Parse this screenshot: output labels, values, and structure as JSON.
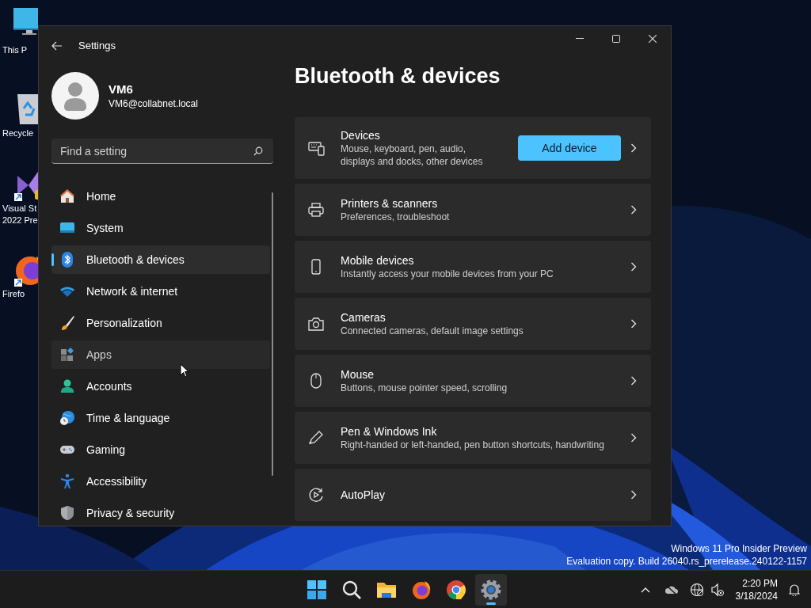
{
  "desktop_icons": [
    {
      "kind": "pc",
      "lines": [
        "This P"
      ]
    },
    {
      "kind": "recycle",
      "lines": [
        "Recycle"
      ]
    },
    {
      "kind": "vs",
      "lines": [
        "Visual St",
        "2022 Pre"
      ]
    },
    {
      "kind": "firefox",
      "lines": [
        "Firefo"
      ]
    }
  ],
  "window": {
    "title": "Settings",
    "user": {
      "name": "VM6",
      "email": "VM6@collabnet.local"
    },
    "search": {
      "placeholder": "Find a setting"
    },
    "nav": [
      {
        "kind": "home",
        "label": "Home",
        "selected": false,
        "hovered": false
      },
      {
        "kind": "system",
        "label": "System",
        "selected": false,
        "hovered": false
      },
      {
        "kind": "bluetooth",
        "label": "Bluetooth & devices",
        "selected": true,
        "hovered": false
      },
      {
        "kind": "network",
        "label": "Network & internet",
        "selected": false,
        "hovered": false
      },
      {
        "kind": "brush",
        "label": "Personalization",
        "selected": false,
        "hovered": false
      },
      {
        "kind": "apps",
        "label": "Apps",
        "selected": false,
        "hovered": true
      },
      {
        "kind": "accounts",
        "label": "Accounts",
        "selected": false,
        "hovered": false
      },
      {
        "kind": "time",
        "label": "Time & language",
        "selected": false,
        "hovered": false
      },
      {
        "kind": "gaming",
        "label": "Gaming",
        "selected": false,
        "hovered": false
      },
      {
        "kind": "accessibility",
        "label": "Accessibility",
        "selected": false,
        "hovered": false
      },
      {
        "kind": "privacy",
        "label": "Privacy & security",
        "selected": false,
        "hovered": false
      }
    ],
    "page_title": "Bluetooth & devices",
    "cards": [
      {
        "kind": "devices",
        "title": "Devices",
        "subtitle": "Mouse, keyboard, pen, audio,\ndisplays and docks, other devices",
        "button": "Add device"
      },
      {
        "kind": "printer",
        "title": "Printers & scanners",
        "subtitle": "Preferences, troubleshoot"
      },
      {
        "kind": "phone",
        "title": "Mobile devices",
        "subtitle": "Instantly access your mobile devices from your PC"
      },
      {
        "kind": "camera",
        "title": "Cameras",
        "subtitle": "Connected cameras, default image settings"
      },
      {
        "kind": "mouse",
        "title": "Mouse",
        "subtitle": "Buttons, mouse pointer speed, scrolling"
      },
      {
        "kind": "pen",
        "title": "Pen & Windows Ink",
        "subtitle": "Right-handed or left-handed, pen button shortcuts, handwriting"
      },
      {
        "kind": "autoplay",
        "title": "AutoPlay"
      }
    ]
  },
  "edition_notice": [
    "Windows 11 Pro Insider Preview",
    "Evaluation copy. Build 26040.rs_prerelease.240122-1157"
  ],
  "taskbar": {
    "apps": [
      {
        "kind": "start",
        "active": false
      },
      {
        "kind": "search",
        "active": false
      },
      {
        "kind": "explorer",
        "active": false
      },
      {
        "kind": "firefox",
        "active": false
      },
      {
        "kind": "chrome",
        "active": false
      },
      {
        "kind": "settings",
        "active": true
      }
    ],
    "time": "2:20 PM",
    "date": "3/18/2024"
  }
}
